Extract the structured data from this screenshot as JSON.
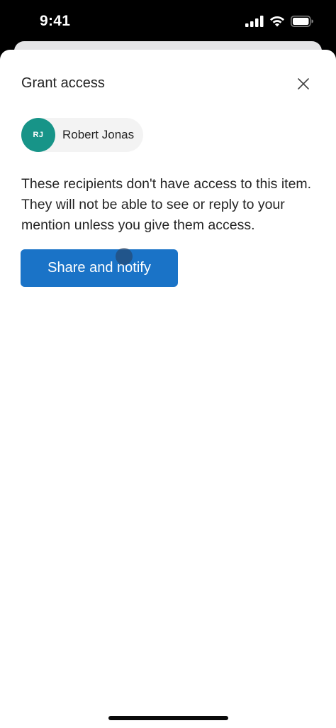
{
  "status_bar": {
    "time": "9:41",
    "icons": [
      "cellular-signal-icon",
      "wifi-icon",
      "battery-icon"
    ]
  },
  "sheet": {
    "title": "Grant access",
    "close_icon": "close-icon"
  },
  "recipient": {
    "initials": "RJ",
    "name": "Robert Jonas",
    "avatar_color": "#179488"
  },
  "message": "These recipients don't have access to this item. They will not be able to see or reply to your mention unless you give them access.",
  "actions": {
    "share_label": "Share and notify",
    "share_color": "#1a73c7"
  }
}
